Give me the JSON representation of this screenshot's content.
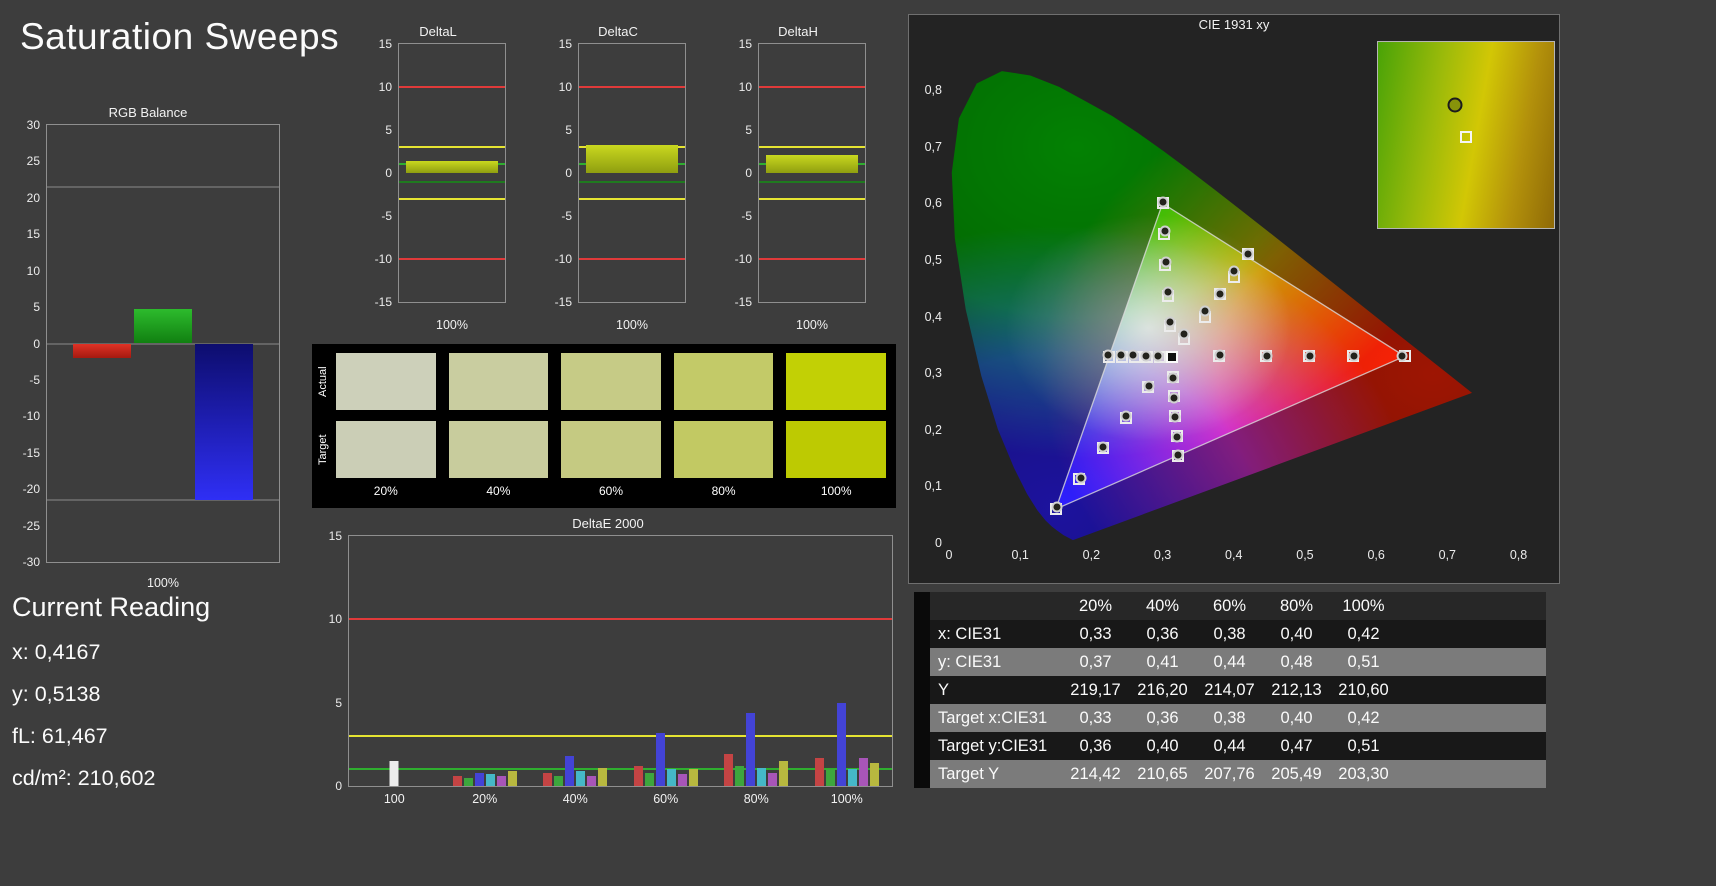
{
  "page": {
    "title": "Saturation Sweeps"
  },
  "current_reading": {
    "heading": "Current Reading",
    "items": [
      "x: 0,4167",
      "y: 0,5138",
      "fL: 61,467",
      "cd/m²: 210,602"
    ]
  },
  "swatches": {
    "row_labels": [
      "Actual",
      "Target"
    ],
    "col_labels": [
      "20%",
      "40%",
      "60%",
      "80%",
      "100%"
    ],
    "actual": [
      "#cdd0ba",
      "#c9cda0",
      "#c6cb86",
      "#c3ca68",
      "#c2d005"
    ],
    "target": [
      "#cbceb6",
      "#c8cc9d",
      "#c5ca82",
      "#c2c963",
      "#bdca02"
    ]
  },
  "table": {
    "headers": [
      "",
      "20%",
      "40%",
      "60%",
      "80%",
      "100%"
    ],
    "rows": [
      {
        "label": "x: CIE31",
        "values": [
          "0,33",
          "0,36",
          "0,38",
          "0,40",
          "0,42"
        ]
      },
      {
        "label": "y: CIE31",
        "values": [
          "0,37",
          "0,41",
          "0,44",
          "0,48",
          "0,51"
        ]
      },
      {
        "label": "Y",
        "values": [
          "219,17",
          "216,20",
          "214,07",
          "212,13",
          "210,60"
        ]
      },
      {
        "label": "Target x:CIE31",
        "values": [
          "0,33",
          "0,36",
          "0,38",
          "0,40",
          "0,42"
        ]
      },
      {
        "label": "Target y:CIE31",
        "values": [
          "0,36",
          "0,40",
          "0,44",
          "0,47",
          "0,51"
        ]
      },
      {
        "label": "Target Y",
        "values": [
          "214,42",
          "210,65",
          "207,76",
          "205,49",
          "203,30"
        ]
      }
    ]
  },
  "chart_data": [
    {
      "id": "rgb_balance",
      "type": "bar",
      "title": "RGB Balance",
      "xlabel": "100%",
      "ylim": [
        -30,
        30
      ],
      "yticks": [
        30,
        25,
        20,
        15,
        10,
        5,
        0,
        -5,
        -10,
        -15,
        -20,
        -25,
        -30
      ],
      "ref_lines": [
        {
          "v": 21.5,
          "color": "rgba(255,255,255,0.4)",
          "h": 1
        },
        {
          "v": 0,
          "color": "rgba(255,255,255,0.4)",
          "h": 1
        },
        {
          "v": -21.5,
          "color": "rgba(255,255,255,0.4)",
          "h": 1
        }
      ],
      "bars": [
        {
          "name": "red",
          "value": -2,
          "gradient": [
            "#e03226",
            "#a51a10"
          ]
        },
        {
          "name": "green",
          "value": 4.8,
          "gradient": [
            "#2dbb2d",
            "#118011"
          ]
        },
        {
          "name": "blue",
          "value": -21.5,
          "gradient": [
            "#0d0d6e",
            "#2f2ff5"
          ]
        }
      ]
    },
    {
      "id": "delta_l",
      "type": "bar",
      "title": "DeltaL",
      "xlabel": "100%",
      "ylim": [
        -15,
        15
      ],
      "yticks": [
        15,
        10,
        5,
        0,
        -5,
        -10,
        -15
      ],
      "ref_lines": [
        {
          "v": 10,
          "color": "#e03a3a",
          "h": 2
        },
        {
          "v": -10,
          "color": "#e03a3a",
          "h": 2
        },
        {
          "v": 3,
          "color": "#e6e432",
          "h": 2
        },
        {
          "v": -3,
          "color": "#e6e432",
          "h": 2
        },
        {
          "v": 1,
          "color": "#2fae2f",
          "h": 2
        },
        {
          "v": -1,
          "color": "#1f7a1f",
          "h": 2
        }
      ],
      "bars": [
        {
          "name": "deltaL-100",
          "value": 1.4,
          "gradient": [
            "#c9d81f",
            "#8f9e10"
          ]
        }
      ]
    },
    {
      "id": "delta_c",
      "type": "bar",
      "title": "DeltaC",
      "xlabel": "100%",
      "ylim": [
        -15,
        15
      ],
      "yticks": [
        15,
        10,
        5,
        0,
        -5,
        -10,
        -15
      ],
      "ref_lines": [
        {
          "v": 10,
          "color": "#e03a3a",
          "h": 2
        },
        {
          "v": -10,
          "color": "#e03a3a",
          "h": 2
        },
        {
          "v": 3,
          "color": "#e6e432",
          "h": 2
        },
        {
          "v": -3,
          "color": "#e6e432",
          "h": 2
        },
        {
          "v": 1,
          "color": "#2fae2f",
          "h": 2
        },
        {
          "v": -1,
          "color": "#1f7a1f",
          "h": 2
        }
      ],
      "bars": [
        {
          "name": "deltaC-100",
          "value": 3.3,
          "gradient": [
            "#c9d81f",
            "#8f9e10"
          ]
        }
      ]
    },
    {
      "id": "delta_h",
      "type": "bar",
      "title": "DeltaH",
      "xlabel": "100%",
      "ylim": [
        -15,
        15
      ],
      "yticks": [
        15,
        10,
        5,
        0,
        -5,
        -10,
        -15
      ],
      "ref_lines": [
        {
          "v": 10,
          "color": "#e03a3a",
          "h": 2
        },
        {
          "v": -10,
          "color": "#e03a3a",
          "h": 2
        },
        {
          "v": 3,
          "color": "#e6e432",
          "h": 2
        },
        {
          "v": -3,
          "color": "#e6e432",
          "h": 2
        },
        {
          "v": 1,
          "color": "#2fae2f",
          "h": 2
        },
        {
          "v": -1,
          "color": "#1f7a1f",
          "h": 2
        }
      ],
      "bars": [
        {
          "name": "deltaH-100",
          "value": 2.1,
          "gradient": [
            "#c9d81f",
            "#8f9e10"
          ]
        }
      ]
    },
    {
      "id": "delta_e_2000",
      "type": "bar",
      "title": "DeltaE 2000",
      "ylim": [
        0,
        15
      ],
      "yticks": [
        15,
        10,
        5,
        0
      ],
      "ref_lines": [
        {
          "v": 10,
          "color": "#e03a3a",
          "h": 2
        },
        {
          "v": 3,
          "color": "#e6e432",
          "h": 2
        },
        {
          "v": 1,
          "color": "#2fae2f",
          "h": 2
        }
      ],
      "groups": [
        {
          "label": "100",
          "bars": [
            {
              "color": "#ececec",
              "value": 1.5
            }
          ]
        },
        {
          "label": "20%",
          "bars": [
            {
              "color": "#c44444",
              "value": 0.6
            },
            {
              "color": "#3da63d",
              "value": 0.5
            },
            {
              "color": "#4343d6",
              "value": 0.8
            },
            {
              "color": "#45b8c8",
              "value": 0.7
            },
            {
              "color": "#a855b8",
              "value": 0.6
            },
            {
              "color": "#b8b83f",
              "value": 0.9
            }
          ]
        },
        {
          "label": "40%",
          "bars": [
            {
              "color": "#c44444",
              "value": 0.8
            },
            {
              "color": "#3da63d",
              "value": 0.6
            },
            {
              "color": "#4343d6",
              "value": 1.8
            },
            {
              "color": "#45b8c8",
              "value": 0.9
            },
            {
              "color": "#a855b8",
              "value": 0.6
            },
            {
              "color": "#b8b83f",
              "value": 1.1
            }
          ]
        },
        {
          "label": "60%",
          "bars": [
            {
              "color": "#c44444",
              "value": 1.2
            },
            {
              "color": "#3da63d",
              "value": 0.8
            },
            {
              "color": "#4343d6",
              "value": 3.2
            },
            {
              "color": "#45b8c8",
              "value": 1.0
            },
            {
              "color": "#a855b8",
              "value": 0.7
            },
            {
              "color": "#b8b83f",
              "value": 1.0
            }
          ]
        },
        {
          "label": "80%",
          "bars": [
            {
              "color": "#c44444",
              "value": 1.9
            },
            {
              "color": "#3da63d",
              "value": 1.2
            },
            {
              "color": "#4343d6",
              "value": 4.4
            },
            {
              "color": "#45b8c8",
              "value": 1.1
            },
            {
              "color": "#a855b8",
              "value": 0.8
            },
            {
              "color": "#b8b83f",
              "value": 1.5
            }
          ]
        },
        {
          "label": "100%",
          "bars": [
            {
              "color": "#c44444",
              "value": 1.7
            },
            {
              "color": "#3da63d",
              "value": 1.0
            },
            {
              "color": "#4343d6",
              "value": 5.0
            },
            {
              "color": "#45b8c8",
              "value": 1.0
            },
            {
              "color": "#a855b8",
              "value": 1.7
            },
            {
              "color": "#b8b83f",
              "value": 1.4
            }
          ]
        }
      ]
    },
    {
      "id": "cie_1931",
      "type": "scatter",
      "title": "CIE 1931 xy",
      "xlim": [
        0,
        0.84
      ],
      "ylim": [
        0,
        0.88
      ],
      "tick_values": [
        0,
        0.1,
        0.2,
        0.3,
        0.4,
        0.5,
        0.6,
        0.7,
        0.8
      ],
      "xtick_labels": [
        "0",
        "0,1",
        "0,2",
        "0,3",
        "0,4",
        "0,5",
        "0,6",
        "0,7",
        "0,8"
      ],
      "ytick_labels": [
        "0",
        "0,1",
        "0,2",
        "0,3",
        "0,4",
        "0,5",
        "0,6",
        "0,7",
        "0,8"
      ],
      "gamut_triangle": [
        [
          0.64,
          0.33
        ],
        [
          0.3,
          0.6
        ],
        [
          0.15,
          0.06
        ]
      ],
      "white_point": [
        0.313,
        0.329
      ],
      "series": [
        {
          "name": "target",
          "marker": "square",
          "points": [
            [
              0.33,
              0.36
            ],
            [
              0.36,
              0.4
            ],
            [
              0.38,
              0.44
            ],
            [
              0.4,
              0.47
            ],
            [
              0.42,
              0.51
            ],
            [
              0.31,
              0.383
            ],
            [
              0.307,
              0.437
            ],
            [
              0.304,
              0.492
            ],
            [
              0.302,
              0.546
            ],
            [
              0.3,
              0.6
            ],
            [
              0.379,
              0.33
            ],
            [
              0.445,
              0.33
            ],
            [
              0.506,
              0.33
            ],
            [
              0.568,
              0.33
            ],
            [
              0.64,
              0.33
            ],
            [
              0.28,
              0.275
            ],
            [
              0.248,
              0.221
            ],
            [
              0.216,
              0.167
            ],
            [
              0.183,
              0.113
            ],
            [
              0.15,
              0.06
            ],
            [
              0.296,
              0.329
            ],
            [
              0.278,
              0.329
            ],
            [
              0.261,
              0.329
            ],
            [
              0.243,
              0.329
            ],
            [
              0.225,
              0.329
            ],
            [
              0.314,
              0.294
            ],
            [
              0.316,
              0.259
            ],
            [
              0.318,
              0.224
            ],
            [
              0.32,
              0.189
            ],
            [
              0.322,
              0.154
            ]
          ]
        },
        {
          "name": "measured",
          "marker": "circle",
          "points": [
            [
              0.33,
              0.37
            ],
            [
              0.36,
              0.41
            ],
            [
              0.38,
              0.44
            ],
            [
              0.4,
              0.48
            ],
            [
              0.42,
              0.51
            ],
            [
              0.31,
              0.39
            ],
            [
              0.307,
              0.443
            ],
            [
              0.305,
              0.497
            ],
            [
              0.303,
              0.551
            ],
            [
              0.301,
              0.603
            ],
            [
              0.38,
              0.332
            ],
            [
              0.446,
              0.331
            ],
            [
              0.507,
              0.331
            ],
            [
              0.569,
              0.33
            ],
            [
              0.637,
              0.33
            ],
            [
              0.281,
              0.277
            ],
            [
              0.249,
              0.224
            ],
            [
              0.217,
              0.169
            ],
            [
              0.185,
              0.115
            ],
            [
              0.152,
              0.063
            ],
            [
              0.294,
              0.331
            ],
            [
              0.277,
              0.331
            ],
            [
              0.259,
              0.332
            ],
            [
              0.241,
              0.332
            ],
            [
              0.224,
              0.332
            ],
            [
              0.314,
              0.292
            ],
            [
              0.316,
              0.257
            ],
            [
              0.318,
              0.222
            ],
            [
              0.32,
              0.187
            ],
            [
              0.322,
              0.156
            ]
          ]
        }
      ],
      "inset": {
        "circle": [
          0.44,
          0.34
        ],
        "square": [
          0.5,
          0.51
        ]
      }
    }
  ]
}
